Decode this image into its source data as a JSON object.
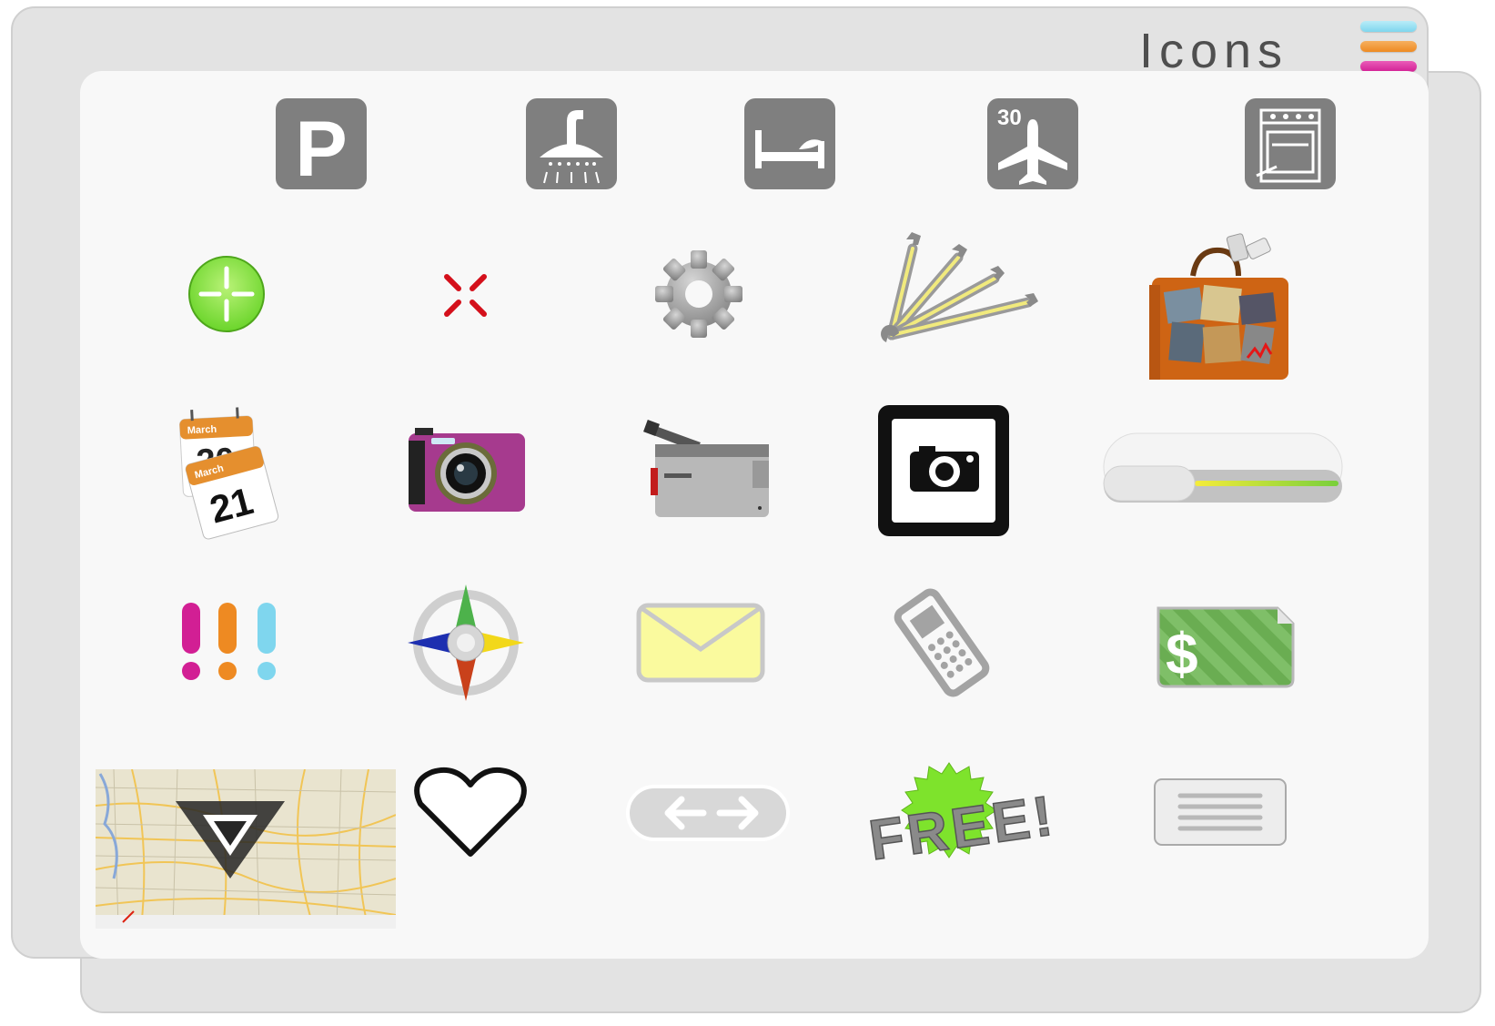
{
  "header": {
    "title": "Icons"
  },
  "colors": {
    "menu_bar_1": "#7fd6ee",
    "menu_bar_2": "#ee8a22",
    "menu_bar_3": "#d21f94"
  },
  "icons": [
    {
      "name": "parking-icon",
      "label": "P"
    },
    {
      "name": "shower-icon"
    },
    {
      "name": "bed-icon"
    },
    {
      "name": "flight-icon",
      "label": "30"
    },
    {
      "name": "stove-icon"
    },
    {
      "name": "add-icon"
    },
    {
      "name": "close-icon"
    },
    {
      "name": "gear-icon"
    },
    {
      "name": "wrenches-icon"
    },
    {
      "name": "travel-bag-icon"
    },
    {
      "name": "calendar-icon",
      "month": "March",
      "day_back": "20",
      "day_front": "21"
    },
    {
      "name": "camera-icon"
    },
    {
      "name": "video-camera-icon"
    },
    {
      "name": "camera-square-icon"
    },
    {
      "name": "slider-icon"
    },
    {
      "name": "exclamations-icon"
    },
    {
      "name": "compass-icon"
    },
    {
      "name": "mail-icon"
    },
    {
      "name": "mobile-phone-icon"
    },
    {
      "name": "money-icon",
      "label": "$"
    },
    {
      "name": "map-icon"
    },
    {
      "name": "heart-icon"
    },
    {
      "name": "arrows-icon"
    },
    {
      "name": "free-icon",
      "label": "FREE!"
    },
    {
      "name": "menu-lines-icon"
    }
  ]
}
